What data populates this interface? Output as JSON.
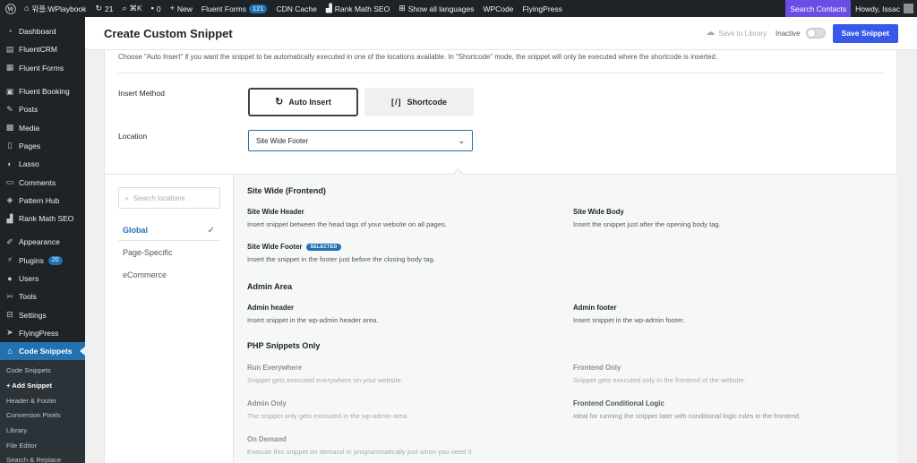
{
  "adminbar": {
    "site_name": "워플:WPlaybook",
    "updates_count": "21",
    "kbd_shortcut": "⌘K",
    "comments_count": "0",
    "new_label": "New",
    "fluent_forms_label": "Fluent Forms",
    "fluent_forms_count": "121",
    "cdn_cache": "CDN Cache",
    "rank_math": "Rank Math SEO",
    "languages": "Show all languages",
    "wpcode": "WPCode",
    "flyingpress": "FlyingPress",
    "search_contacts": "Search Contacts",
    "howdy": "Howdy, Issac"
  },
  "sidebar": {
    "items": [
      {
        "label": "Dashboard",
        "icon": "dashboard-icon"
      },
      {
        "label": "FluentCRM",
        "icon": "crm-icon"
      },
      {
        "label": "Fluent Forms",
        "icon": "forms-icon"
      },
      {
        "label": "Fluent Booking",
        "icon": "booking-icon"
      },
      {
        "label": "Posts",
        "icon": "pin-icon"
      },
      {
        "label": "Media",
        "icon": "media-icon"
      },
      {
        "label": "Pages",
        "icon": "pages-icon"
      },
      {
        "label": "Lasso",
        "icon": "lasso-icon"
      },
      {
        "label": "Comments",
        "icon": "comment-icon"
      },
      {
        "label": "Pattern Hub",
        "icon": "pattern-icon"
      },
      {
        "label": "Rank Math SEO",
        "icon": "rankmath-icon"
      },
      {
        "label": "Appearance",
        "icon": "brush-icon"
      },
      {
        "label": "Plugins",
        "icon": "plug-icon",
        "badge": "20"
      },
      {
        "label": "Users",
        "icon": "user-icon"
      },
      {
        "label": "Tools",
        "icon": "wrench-icon"
      },
      {
        "label": "Settings",
        "icon": "settings-icon"
      },
      {
        "label": "FlyingPress",
        "icon": "flyingpress-icon"
      },
      {
        "label": "Code Snippets",
        "icon": "code-icon"
      }
    ],
    "submenu": [
      "Code Snippets",
      "+ Add Snippet",
      "Header & Footer",
      "Conversion Pixels",
      "Library",
      "File Editor",
      "Search & Replace"
    ]
  },
  "header": {
    "title": "Create Custom Snippet",
    "save_to_library": "Save to Library",
    "status_label": "Inactive",
    "save_button": "Save Snippet"
  },
  "panel": {
    "description": "Choose \"Auto Insert\" if you want the snippet to be automatically executed in one of the locations available. In \"Shortcode\" mode, the snippet will only be executed where the shortcode is inserted.",
    "insert_method_label": "Insert Method",
    "auto_insert": "Auto Insert",
    "shortcode": "Shortcode",
    "location_label": "Location",
    "location_value": "Site Wide Footer"
  },
  "dropdown": {
    "search_placeholder": "Search locations",
    "categories": [
      "Global",
      "Page-Specific",
      "eCommerce"
    ],
    "groups": [
      {
        "title": "Site Wide (Frontend)",
        "options": [
          {
            "title": "Site Wide Header",
            "desc": "Insert snippet between the head tags of your website on all pages."
          },
          {
            "title": "Site Wide Body",
            "desc": "Insert the snippet just after the opening body tag."
          },
          {
            "title": "Site Wide Footer",
            "desc": "Insert the snippet in the footer just before the closing body tag.",
            "badge": "SELECTED"
          }
        ]
      },
      {
        "title": "Admin Area",
        "options": [
          {
            "title": "Admin header",
            "desc": "Insert snippet in the wp-admin header area."
          },
          {
            "title": "Admin footer",
            "desc": "Insert snippet in the wp-admin footer."
          }
        ]
      },
      {
        "title": "PHP Snippets Only",
        "options": [
          {
            "title": "Run Everywhere",
            "desc": "Snippet gets executed everywhere on your website."
          },
          {
            "title": "Frontend Only",
            "desc": "Snippet gets executed only in the frontend of the website."
          },
          {
            "title": "Admin Only",
            "desc": "The snippet only gets executed in the wp-admin area."
          },
          {
            "title": "Frontend Conditional Logic",
            "desc": "Ideal for running the snippet later with conditional logic rules in the frontend."
          },
          {
            "title": "On Demand",
            "desc": "Execute this snippet on demand or programmatically just when you need it."
          }
        ]
      }
    ]
  },
  "colors": {
    "admin_bg": "#1d2327",
    "accent_blue": "#2271b1",
    "save_button": "#3858e9",
    "search_contacts": "#6b4de6"
  }
}
